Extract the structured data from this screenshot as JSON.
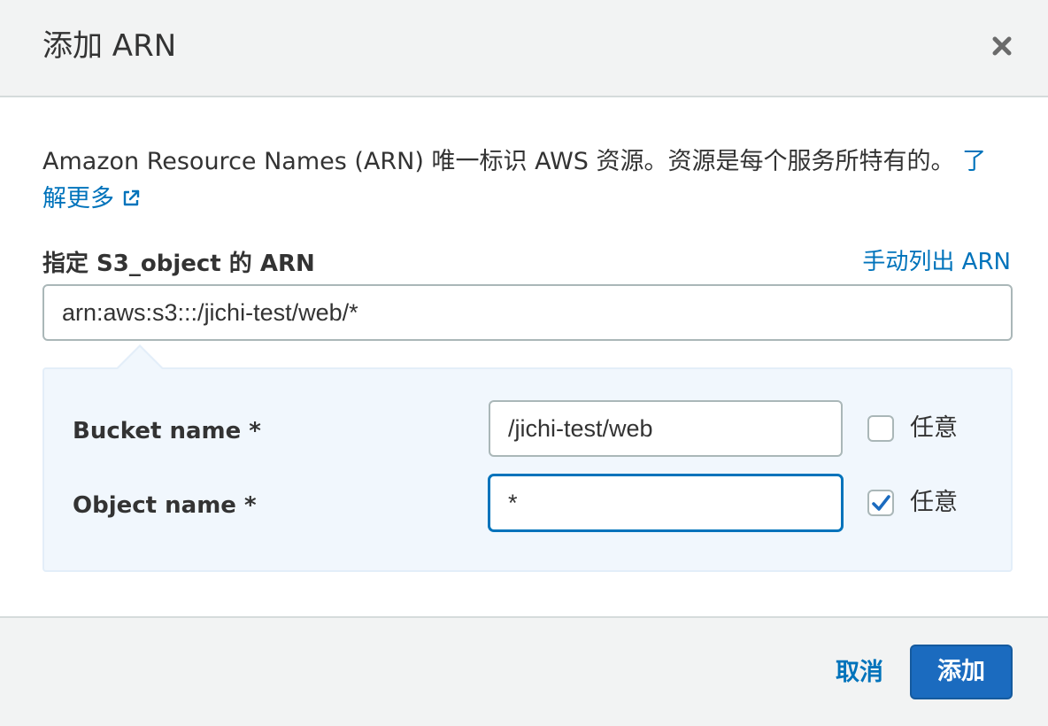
{
  "header": {
    "title": "添加 ARN",
    "close_icon": "close-icon"
  },
  "description": {
    "text": "Amazon Resource Names (ARN) 唯一标识 AWS 资源。资源是每个服务所特有的。",
    "learn_more": "了解更多",
    "learn_more_icon": "external-link-icon"
  },
  "arn_field": {
    "label": "指定 S3_object 的 ARN",
    "manual_link": "手动列出 ARN",
    "value": "arn:aws:s3:::/jichi-test/web/*"
  },
  "builder": {
    "rows": [
      {
        "label": "Bucket name *",
        "value": "/jichi-test/web",
        "any_label": "任意",
        "any_checked": false
      },
      {
        "label": "Object name *",
        "value": "*",
        "any_label": "任意",
        "any_checked": true
      }
    ]
  },
  "footer": {
    "cancel_label": "取消",
    "add_label": "添加"
  },
  "colors": {
    "link": "#0073bb",
    "primary": "#1b6bbf",
    "panel_bg": "#f1f7fd",
    "header_bg": "#f2f3f3"
  }
}
